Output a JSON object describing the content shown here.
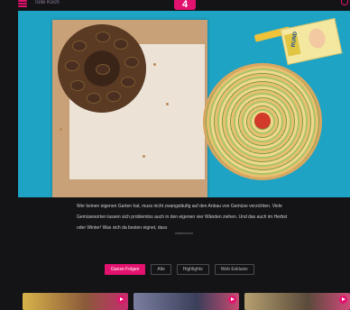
{
  "header": {
    "brand_text": "Tolle Koch",
    "logo_text": "4",
    "icons": [
      "menu-icon",
      "search-icon"
    ],
    "accent_color": "#e2126e"
  },
  "hero": {
    "image_label": "Zwei Tartes mit Pflaumen und Gemüse",
    "package_text": "RUND"
  },
  "description": {
    "text": "Wer keinen eigenen Garten hat, muss nicht zwangsläufig auf den Anbau von Gemüse verzichten. Viele Gemüsesorten lassen sich problemlos auch in den eigenen vier Wänden ziehen. Und das auch im Herbst oder Winter! Was sich da besten eignet, dass",
    "more_label": "weiterlesen"
  },
  "tabs": [
    {
      "label": "Ganze Folgen",
      "active": true
    },
    {
      "label": "Alle",
      "active": false
    },
    {
      "label": "Highlights",
      "active": false
    },
    {
      "label": "Web Exklusiv",
      "active": false
    }
  ],
  "thumbnails": [
    {
      "name": "episode-1",
      "colors": [
        "#d8b34a",
        "#c72c6e"
      ]
    },
    {
      "name": "episode-2",
      "colors": [
        "#7a7fa0",
        "#c84a70"
      ]
    },
    {
      "name": "episode-3",
      "colors": [
        "#b6a070",
        "#d04a7a"
      ]
    }
  ]
}
